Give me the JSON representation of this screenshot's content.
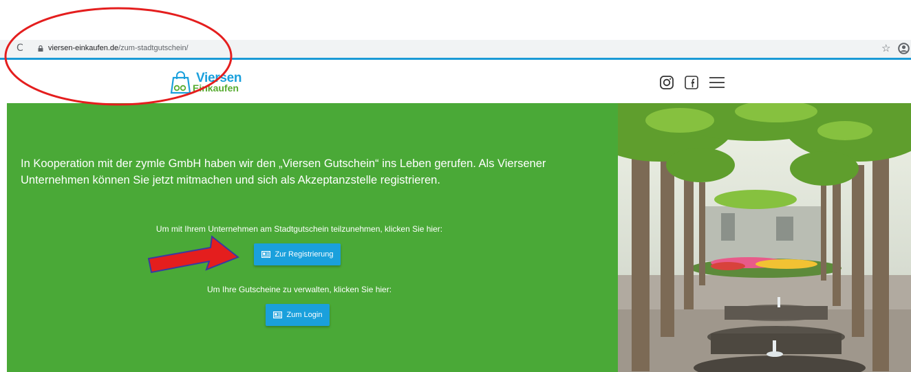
{
  "browser": {
    "url_domain": "viersen-einkaufen.de",
    "url_path": "/zum-stadtgutschein/",
    "reload_icon": "reload-icon",
    "lock_icon": "lock-icon",
    "bookmark_icon": "star-icon",
    "profile_icon": "profile-icon"
  },
  "header": {
    "logo_line1": "Viersen",
    "logo_line2": "Einkaufen",
    "icons": [
      "instagram-icon",
      "facebook-icon",
      "hamburger-menu-icon"
    ]
  },
  "hero": {
    "intro": "In Kooperation mit der zymle GmbH haben wir den „Viersen Gutschein“ ins Leben gerufen. Als Viersener Unternehmen können Sie jetzt mitmachen und sich als Akzeptanzstelle registrieren.",
    "register_prompt": "Um mit Ihrem Unternehmen am Stadtgutschein teilzunehmen, klicken Sie hier:",
    "register_button": "Zur Registrierung",
    "login_prompt": "Um Ihre Gutscheine zu verwalten, klicken Sie hier:",
    "login_button": "Zum Login"
  },
  "colors": {
    "hero_green": "#4aa937",
    "button_blue": "#1aa0dc",
    "logo_blue": "#1aa0dc",
    "logo_green": "#56ab2f",
    "annotation_red": "#e41e1e"
  }
}
